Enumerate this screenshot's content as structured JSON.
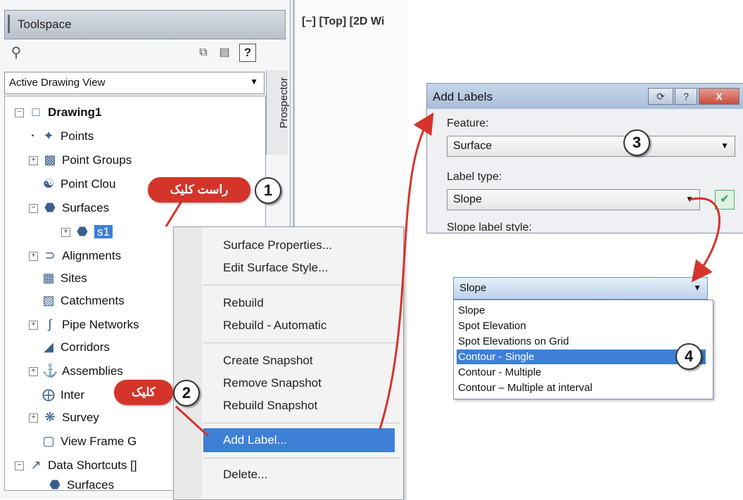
{
  "toolspace": {
    "title": "Toolspace",
    "view_selector": "Active Drawing View",
    "help_label": "?",
    "prospector_tab": "Prospector",
    "tree": {
      "root": "Drawing1",
      "items": [
        {
          "label": "Points"
        },
        {
          "label": "Point Groups"
        },
        {
          "label": "Point Clou"
        },
        {
          "label": "Surfaces"
        },
        {
          "label": "s1"
        },
        {
          "label": "Alignments"
        },
        {
          "label": "Sites"
        },
        {
          "label": "Catchments"
        },
        {
          "label": "Pipe Networks"
        },
        {
          "label": "Corridors"
        },
        {
          "label": "Assemblies"
        },
        {
          "label": "Inter"
        },
        {
          "label": "Survey"
        },
        {
          "label": "View Frame G"
        },
        {
          "label": "Data Shortcuts []"
        },
        {
          "label": "Surfaces"
        }
      ]
    }
  },
  "viewport": {
    "label": "[−] [Top] [2D Wi"
  },
  "context_menu": {
    "items": [
      "Surface Properties...",
      "Edit Surface Style...",
      "Rebuild",
      "Rebuild - Automatic",
      "Create Snapshot",
      "Remove Snapshot",
      "Rebuild Snapshot",
      "Add Label...",
      "Delete..."
    ]
  },
  "add_labels_dialog": {
    "title": "Add Labels",
    "feature_label": "Feature:",
    "feature_value": "Surface",
    "label_type_label": "Label type:",
    "label_type_value": "Slope",
    "slope_style_label": "Slope label style:",
    "close_label": "X",
    "help_label": "?"
  },
  "label_type_dropdown": {
    "selected": "Slope",
    "options": [
      "Slope",
      "Spot Elevation",
      "Spot Elevations on Grid",
      "Contour - Single",
      "Contour - Multiple",
      "Contour – Multiple at interval"
    ],
    "highlighted_index": 3
  },
  "callouts": {
    "step1_num": "1",
    "step1_text": "راست کلیک",
    "step2_num": "2",
    "step2_text": "کلیک",
    "step3_num": "3",
    "step4_num": "4"
  },
  "colors": {
    "selection": "#3e7fd6",
    "callout_red": "#d4342a",
    "arrow_red": "#d4342a"
  }
}
